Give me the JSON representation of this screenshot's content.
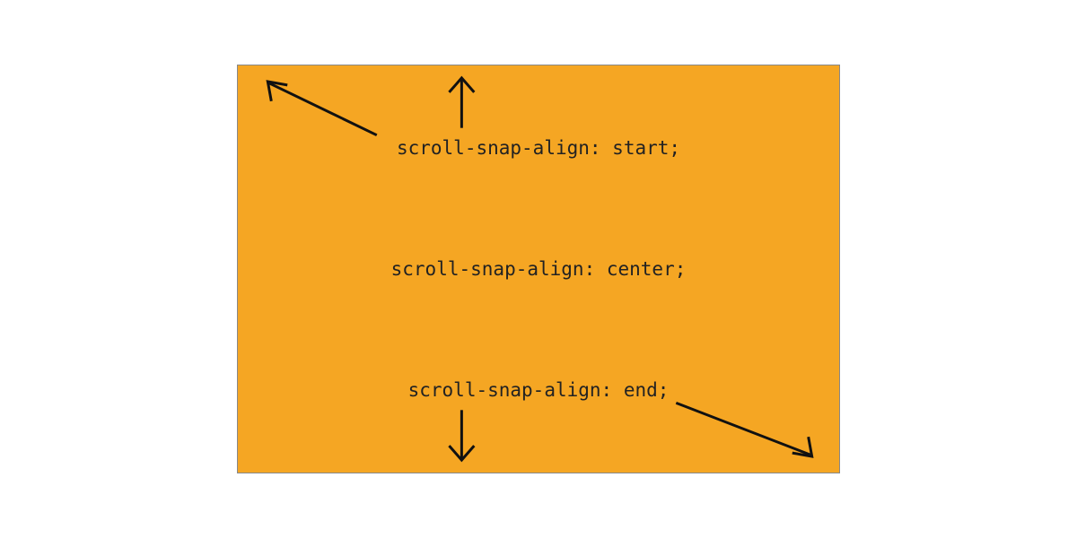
{
  "labels": {
    "start": "scroll-snap-align: start;",
    "center": "scroll-snap-align: center;",
    "end": "scroll-snap-align: end;"
  },
  "colors": {
    "box": "#f5a623",
    "arrow": "#111111"
  },
  "arrows": [
    {
      "name": "up",
      "from": "label-start",
      "to": "top-edge"
    },
    {
      "name": "up-left",
      "from": "label-start",
      "to": "top-left-corner"
    },
    {
      "name": "down",
      "from": "label-end",
      "to": "bottom-edge"
    },
    {
      "name": "down-right",
      "from": "label-end",
      "to": "bottom-right-corner"
    }
  ]
}
